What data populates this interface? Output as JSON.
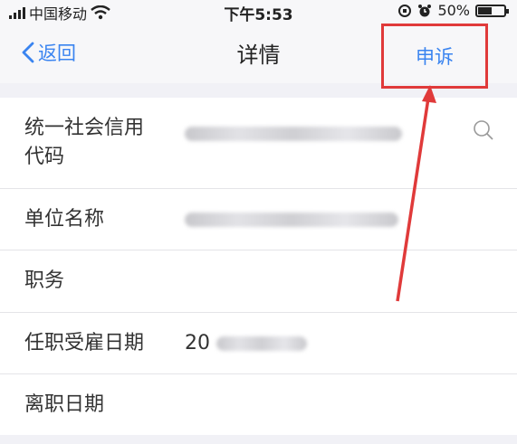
{
  "status_bar": {
    "carrier": "中国移动",
    "time": "下午5:53",
    "battery": "50%"
  },
  "nav": {
    "back_label": "返回",
    "title": "详情",
    "appeal_label": "申诉"
  },
  "fields": [
    {
      "label": "统一社会信用代码",
      "value_visible": ""
    },
    {
      "label": "单位名称",
      "value_visible": ""
    },
    {
      "label": "职务",
      "value_visible": ""
    },
    {
      "label": "任职受雇日期",
      "value_visible": "20"
    },
    {
      "label": "离职日期",
      "value_visible": ""
    }
  ],
  "colors": {
    "accent": "#3a84f0",
    "annotation": "#e03a3a"
  }
}
